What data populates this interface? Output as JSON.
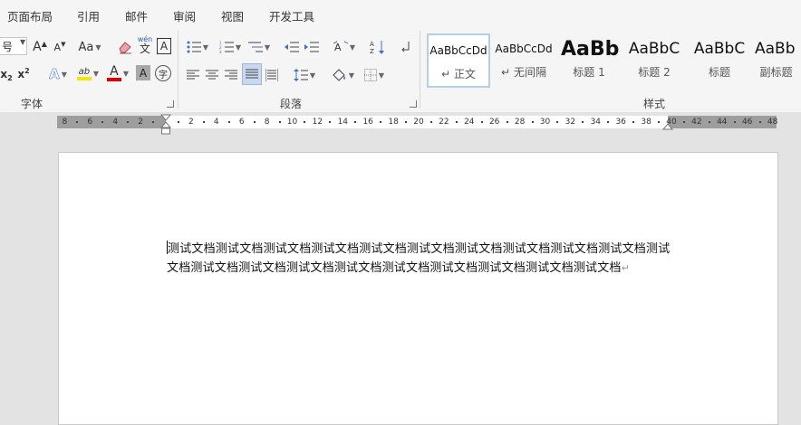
{
  "tabs": [
    "页面布局",
    "引用",
    "邮件",
    "审阅",
    "视图",
    "开发工具"
  ],
  "font_group": {
    "label": "字体",
    "size_value": "号",
    "grow": "A",
    "shrink": "A",
    "change_case": "Aa",
    "phonetic_top": "wén",
    "phonetic_bottom": "文",
    "char_border": "A",
    "subscript": "x",
    "subscript_sub": "2",
    "superscript": "x",
    "superscript_sup": "2",
    "text_effect": "A",
    "highlight": "ab",
    "font_color": "A",
    "char_shading": "A",
    "enclose": "字"
  },
  "paragraph_group": {
    "label": "段落"
  },
  "styles_group": {
    "label": "样式",
    "styles": [
      {
        "sample": "AaBbCcDd",
        "name": "正文",
        "mark": "↵",
        "selected": true
      },
      {
        "sample": "AaBbCcDd",
        "name": "无间隔",
        "mark": "↵",
        "selected": false
      },
      {
        "sample": "AaBb",
        "name": "标题 1",
        "mark": "",
        "selected": false
      },
      {
        "sample": "AaBbC",
        "name": "标题 2",
        "mark": "",
        "selected": false
      },
      {
        "sample": "AaBbC",
        "name": "标题",
        "mark": "",
        "selected": false
      },
      {
        "sample": "AaBb",
        "name": "副标题",
        "mark": "",
        "selected": false
      }
    ]
  },
  "ruler": {
    "left_labels": [
      "8",
      "6",
      "4",
      "2"
    ],
    "right_labels": [
      "2",
      "4",
      "6",
      "8",
      "10",
      "12",
      "14",
      "16",
      "18",
      "20",
      "22",
      "24",
      "26",
      "28",
      "30",
      "32",
      "34",
      "36",
      "38",
      "40",
      "42",
      "44",
      "46",
      "48"
    ]
  },
  "document": {
    "text": "测试文档测试文档测试文档测试文档测试文档测试文档测试文档测试文档测试文档测试文档测试文档测试文档测试文档测试文档测试文档测试文档测试文档测试文档测试文档测试文档",
    "paragraph_mark": "↵"
  },
  "colors": {
    "highlight": "#f5e500",
    "font_color": "#d40000",
    "accent_border": "#b4cdea"
  }
}
